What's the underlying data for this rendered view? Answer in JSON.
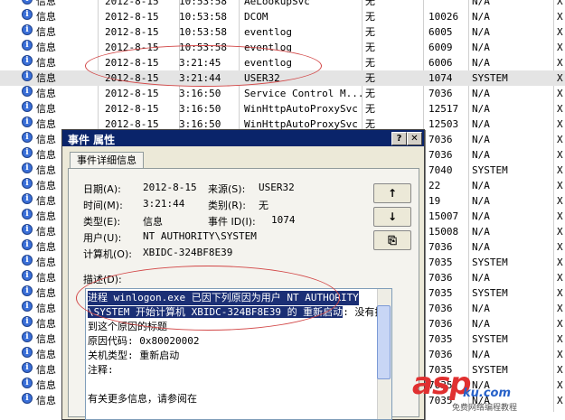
{
  "events": [
    {
      "type": "信息",
      "date": "2012-8-15",
      "time": "10:53:58",
      "source": "AeLookupSvc",
      "category": "无",
      "id": "",
      "user": "N/A",
      "x": "X"
    },
    {
      "type": "信息",
      "date": "2012-8-15",
      "time": "10:53:58",
      "source": "DCOM",
      "category": "无",
      "id": "10026",
      "user": "N/A",
      "x": "X"
    },
    {
      "type": "信息",
      "date": "2012-8-15",
      "time": "10:53:58",
      "source": "eventlog",
      "category": "无",
      "id": "6005",
      "user": "N/A",
      "x": "X"
    },
    {
      "type": "信息",
      "date": "2012-8-15",
      "time": "10:53:58",
      "source": "eventlog",
      "category": "无",
      "id": "6009",
      "user": "N/A",
      "x": "X"
    },
    {
      "type": "信息",
      "date": "2012-8-15",
      "time": "3:21:45",
      "source": "eventlog",
      "category": "无",
      "id": "6006",
      "user": "N/A",
      "x": "X"
    },
    {
      "type": "信息",
      "date": "2012-8-15",
      "time": "3:21:44",
      "source": "USER32",
      "category": "无",
      "id": "1074",
      "user": "SYSTEM",
      "x": "X"
    },
    {
      "type": "信息",
      "date": "2012-8-15",
      "time": "3:16:50",
      "source": "Service Control M...",
      "category": "无",
      "id": "7036",
      "user": "N/A",
      "x": "X"
    },
    {
      "type": "信息",
      "date": "2012-8-15",
      "time": "3:16:50",
      "source": "WinHttpAutoProxySvc",
      "category": "无",
      "id": "12517",
      "user": "N/A",
      "x": "X"
    },
    {
      "type": "信息",
      "date": "2012-8-15",
      "time": "3:16:50",
      "source": "WinHttpAutoProxySvc",
      "category": "无",
      "id": "12503",
      "user": "N/A",
      "x": "X"
    },
    {
      "type": "信息",
      "date": "",
      "time": "",
      "source": "",
      "category": "",
      "id": "7036",
      "user": "N/A",
      "x": "X"
    },
    {
      "type": "信息",
      "date": "",
      "time": "",
      "source": "",
      "category": "",
      "id": "7036",
      "user": "N/A",
      "x": "X"
    },
    {
      "type": "信息",
      "date": "",
      "time": "",
      "source": "",
      "category": "",
      "id": "7040",
      "user": "SYSTEM",
      "x": "X"
    },
    {
      "type": "信息",
      "date": "",
      "time": "",
      "source": "",
      "category": "",
      "id": "22",
      "user": "N/A",
      "x": "X"
    },
    {
      "type": "信息",
      "date": "",
      "time": "",
      "source": "",
      "category": "",
      "id": "19",
      "user": "N/A",
      "x": "X"
    },
    {
      "type": "信息",
      "date": "",
      "time": "",
      "source": "",
      "category": "",
      "id": "15007",
      "user": "N/A",
      "x": "X"
    },
    {
      "type": "信息",
      "date": "",
      "time": "",
      "source": "",
      "category": "",
      "id": "15008",
      "user": "N/A",
      "x": "X"
    },
    {
      "type": "信息",
      "date": "",
      "time": "",
      "source": "",
      "category": "",
      "id": "7036",
      "user": "N/A",
      "x": "X"
    },
    {
      "type": "信息",
      "date": "",
      "time": "",
      "source": "",
      "category": "",
      "id": "7035",
      "user": "SYSTEM",
      "x": "X"
    },
    {
      "type": "信息",
      "date": "",
      "time": "",
      "source": "",
      "category": "",
      "id": "7036",
      "user": "N/A",
      "x": "X"
    },
    {
      "type": "信息",
      "date": "",
      "time": "",
      "source": "",
      "category": "",
      "id": "7035",
      "user": "SYSTEM",
      "x": "X"
    },
    {
      "type": "信息",
      "date": "",
      "time": "",
      "source": "",
      "category": "",
      "id": "7036",
      "user": "N/A",
      "x": "X"
    },
    {
      "type": "信息",
      "date": "",
      "time": "",
      "source": "",
      "category": "",
      "id": "7036",
      "user": "N/A",
      "x": "X"
    },
    {
      "type": "信息",
      "date": "",
      "time": "",
      "source": "",
      "category": "",
      "id": "7035",
      "user": "SYSTEM",
      "x": "X"
    },
    {
      "type": "信息",
      "date": "",
      "time": "",
      "source": "",
      "category": "",
      "id": "7036",
      "user": "N/A",
      "x": "X"
    },
    {
      "type": "信息",
      "date": "",
      "time": "",
      "source": "",
      "category": "",
      "id": "7035",
      "user": "SYSTEM",
      "x": "X"
    },
    {
      "type": "信息",
      "date": "",
      "time": "",
      "source": "",
      "category": "",
      "id": "7035",
      "user": "N/A",
      "x": "X"
    },
    {
      "type": "信息",
      "date": "",
      "time": "",
      "source": "",
      "category": "",
      "id": "7035",
      "user": "N/A",
      "x": "X"
    }
  ],
  "selected_row": 5,
  "dialog": {
    "title": "事件 属性",
    "help_btn": "?",
    "close_btn": "✕",
    "tab": "事件详细信息",
    "date_label": "日期(A):",
    "date_value": "2012-8-15",
    "source_label": "来源(S):",
    "source_value": "USER32",
    "time_label": "时间(M):",
    "time_value": "3:21:44",
    "category_label": "类别(R):",
    "category_value": "无",
    "type_label": "类型(E):",
    "type_value": "信息",
    "eventid_label": "事件 ID(I):",
    "eventid_value": "1074",
    "user_label": "用户(U):",
    "user_value": "NT AUTHORITY\\SYSTEM",
    "computer_label": "计算机(O):",
    "computer_value": "XBIDC-324BF8E39",
    "desc_label": "描述(D):",
    "desc_lines": [
      "进程 winlogon.exe 已因下列原因为用户 NT AUTHORITY",
      "\\SYSTEM 开始计算机 XBIDC-324BF8E39 的 重新启动",
      "到这个原因的标题",
      " 原因代码: 0x80020002",
      " 关机类型: 重新启动",
      " 注释:",
      "",
      "有关更多信息，请参阅在"
    ],
    "desc_line2_tail": ": 没有找",
    "btn_up": "↑",
    "btn_down": "↓",
    "btn_copy": "⎘"
  },
  "watermark": {
    "main": "asp",
    "sub": "ku.com",
    "small": "免费网络编程教程"
  }
}
